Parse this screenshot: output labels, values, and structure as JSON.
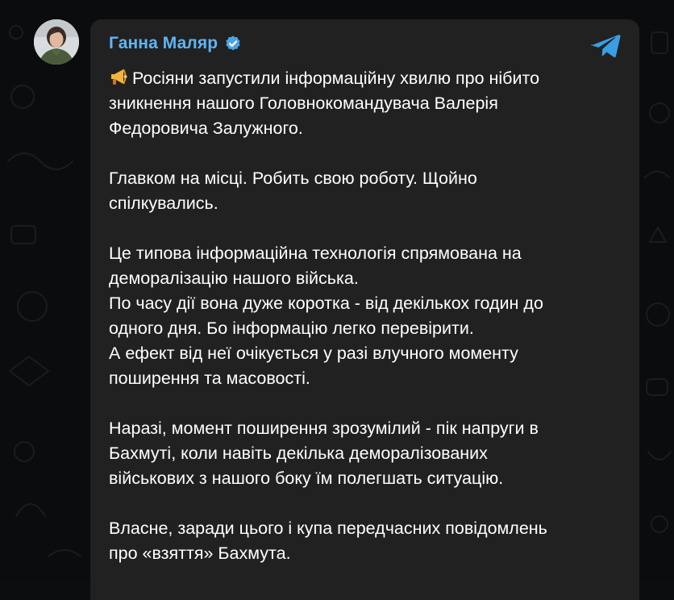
{
  "channel": {
    "sender_name": "Ганна Маляр",
    "verified": true,
    "app_icon": "telegram-icon",
    "avatar_icon": "avatar-photo"
  },
  "colors": {
    "background": "#0b0c0e",
    "bubble": "#212121",
    "sender_name": "#5eb5f7",
    "text": "#ffffff",
    "telegram_blue": "#3a9ee4"
  },
  "message": {
    "lead_emoji": "megaphone-icon",
    "paragraphs": [
      {
        "lines": [
          "Росіяни запустили інформаційну хвилю про нібито",
          "зникнення нашого Головнокомандувача Валерія",
          "Федоровича Залужного."
        ]
      },
      {
        "lines": [
          "Главком на місці. Робить свою роботу. Щойно",
          "спілкувались."
        ]
      },
      {
        "lines": [
          "Це типова інформаційна технологія спрямована на",
          "деморалізацію нашого війська.",
          "По часу дії вона дуже коротка - від декількох годин до",
          "одного дня. Бо інформацію легко перевірити.",
          "А ефект від неї очікується у разі влучного моменту",
          "поширення та масовості."
        ]
      },
      {
        "lines": [
          "Наразі, момент поширення зрозумілий - пік напруги в",
          "Бахмуті, коли навіть декілька деморалізованих",
          "військових з нашого боку їм полегшать ситуацію."
        ]
      },
      {
        "lines": [
          "Власне, заради цього і купа передчасних повідомлень",
          "про «взяття» Бахмута."
        ]
      }
    ]
  }
}
